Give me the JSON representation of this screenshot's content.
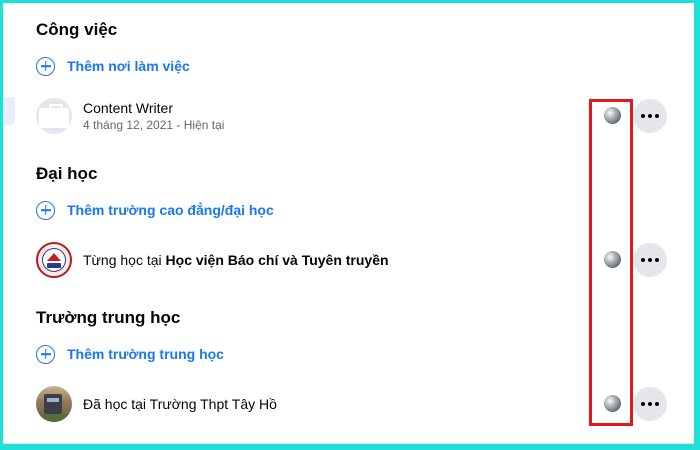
{
  "work": {
    "title": "Công việc",
    "add_label": "Thêm nơi làm việc",
    "entry": {
      "title": "Content Writer",
      "subtitle": "4 tháng 12, 2021 - Hiện tại"
    }
  },
  "college": {
    "title": "Đại học",
    "add_label": "Thêm trường cao đẳng/đại học",
    "entry": {
      "prefix": "Từng học tại ",
      "school": "Học viện Báo chí và Tuyên truyền"
    }
  },
  "highschool": {
    "title": "Trường trung học",
    "add_label": "Thêm trường trung học",
    "entry": {
      "text": "Đã học tại Trường Thpt Tây Hồ"
    }
  },
  "icons": {
    "add": "plus-circle-icon",
    "privacy": "globe-icon",
    "more": "more-horizontal-icon"
  },
  "colors": {
    "accent": "#1877f2",
    "highlight": "#e1191f",
    "frame": "#1fe0d8"
  }
}
